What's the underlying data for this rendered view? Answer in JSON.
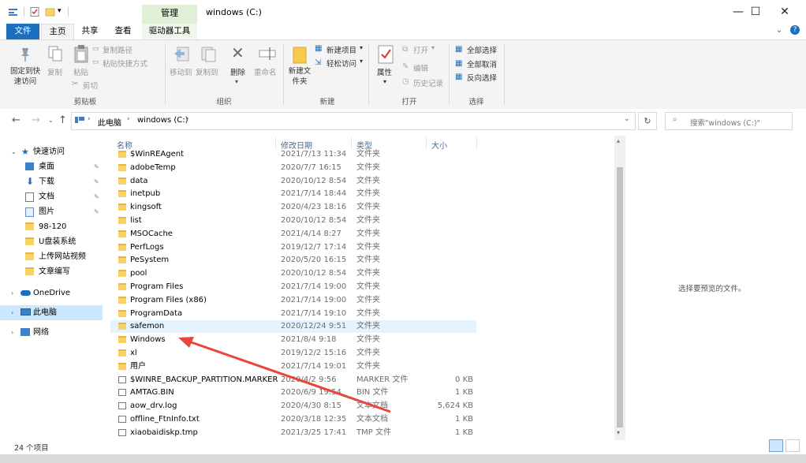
{
  "window": {
    "title": "windows (C:)",
    "contextual_tab": "管理",
    "controls": {
      "minimize": "—",
      "maximize": "☐",
      "close": "✕"
    }
  },
  "tabs": {
    "file": "文件",
    "home": "主页",
    "share": "共享",
    "view": "查看",
    "drive_tools": "驱动器工具"
  },
  "ribbon": {
    "clipboard": {
      "pin": "固定到快速访问",
      "copy": "复制",
      "paste": "粘贴",
      "copy_path": "复制路径",
      "paste_shortcut": "粘贴快捷方式",
      "cut": "剪切",
      "label": "剪贴板"
    },
    "organize": {
      "move_to": "移动到",
      "copy_to": "复制到",
      "delete": "删除",
      "rename": "重命名",
      "label": "组织"
    },
    "new": {
      "new_folder": "新建文件夹",
      "new_item": "新建项目",
      "easy_access": "轻松访问",
      "label": "新建"
    },
    "open": {
      "properties": "属性",
      "open": "打开",
      "edit": "编辑",
      "history": "历史记录",
      "label": "打开"
    },
    "select": {
      "select_all": "全部选择",
      "select_none": "全部取消",
      "invert": "反向选择",
      "label": "选择"
    }
  },
  "address": {
    "breadcrumb_1": "此电脑",
    "breadcrumb_2": "windows (C:)",
    "search_placeholder": "搜索\"windows (C:)\""
  },
  "nav": {
    "quick_access": "快速访问",
    "items": [
      {
        "label": "桌面",
        "pinned": true
      },
      {
        "label": "下载",
        "pinned": true
      },
      {
        "label": "文档",
        "pinned": true
      },
      {
        "label": "图片",
        "pinned": true
      },
      {
        "label": "98-120"
      },
      {
        "label": "U盘装系统"
      },
      {
        "label": "上传网站视频"
      },
      {
        "label": "文章编写"
      }
    ],
    "onedrive": "OneDrive",
    "this_pc": "此电脑",
    "network": "网络"
  },
  "columns": {
    "name": "名称",
    "date": "修改日期",
    "type": "类型",
    "size": "大小"
  },
  "files": [
    {
      "name": "$WinREAgent",
      "date": "2021/7/13 11:34",
      "type": "文件夹",
      "size": "",
      "kind": "folder"
    },
    {
      "name": "adobeTemp",
      "date": "2020/7/7 16:15",
      "type": "文件夹",
      "size": "",
      "kind": "folder"
    },
    {
      "name": "data",
      "date": "2020/10/12 8:54",
      "type": "文件夹",
      "size": "",
      "kind": "folder"
    },
    {
      "name": "inetpub",
      "date": "2021/7/14 18:44",
      "type": "文件夹",
      "size": "",
      "kind": "folder"
    },
    {
      "name": "kingsoft",
      "date": "2020/4/23 18:16",
      "type": "文件夹",
      "size": "",
      "kind": "folder"
    },
    {
      "name": "list",
      "date": "2020/10/12 8:54",
      "type": "文件夹",
      "size": "",
      "kind": "folder"
    },
    {
      "name": "MSOCache",
      "date": "2021/4/14 8:27",
      "type": "文件夹",
      "size": "",
      "kind": "folder"
    },
    {
      "name": "PerfLogs",
      "date": "2019/12/7 17:14",
      "type": "文件夹",
      "size": "",
      "kind": "folder"
    },
    {
      "name": "PeSystem",
      "date": "2020/5/20 16:15",
      "type": "文件夹",
      "size": "",
      "kind": "folder"
    },
    {
      "name": "pool",
      "date": "2020/10/12 8:54",
      "type": "文件夹",
      "size": "",
      "kind": "folder"
    },
    {
      "name": "Program Files",
      "date": "2021/7/14 19:00",
      "type": "文件夹",
      "size": "",
      "kind": "folder"
    },
    {
      "name": "Program Files (x86)",
      "date": "2021/7/14 19:00",
      "type": "文件夹",
      "size": "",
      "kind": "folder"
    },
    {
      "name": "ProgramData",
      "date": "2021/7/14 19:10",
      "type": "文件夹",
      "size": "",
      "kind": "folder"
    },
    {
      "name": "safemon",
      "date": "2020/12/24 9:51",
      "type": "文件夹",
      "size": "",
      "kind": "folder"
    },
    {
      "name": "Windows",
      "date": "2021/8/4 9:18",
      "type": "文件夹",
      "size": "",
      "kind": "folder"
    },
    {
      "name": "xl",
      "date": "2019/12/2 15:16",
      "type": "文件夹",
      "size": "",
      "kind": "folder"
    },
    {
      "name": "用户",
      "date": "2021/7/14 19:01",
      "type": "文件夹",
      "size": "",
      "kind": "folder"
    },
    {
      "name": "$WINRE_BACKUP_PARTITION.MARKER",
      "date": "2020/4/2 9:56",
      "type": "MARKER 文件",
      "size": "0 KB",
      "kind": "file"
    },
    {
      "name": "AMTAG.BIN",
      "date": "2020/6/9 19:54",
      "type": "BIN 文件",
      "size": "1 KB",
      "kind": "file"
    },
    {
      "name": "aow_drv.log",
      "date": "2020/4/30 8:15",
      "type": "文本文档",
      "size": "5,624 KB",
      "kind": "doc"
    },
    {
      "name": "offline_FtnInfo.txt",
      "date": "2020/3/18 12:35",
      "type": "文本文档",
      "size": "1 KB",
      "kind": "doc"
    },
    {
      "name": "xiaobaidiskp.tmp",
      "date": "2021/3/25 17:41",
      "type": "TMP 文件",
      "size": "1 KB",
      "kind": "file"
    }
  ],
  "preview_text": "选择要预览的文件。",
  "status": {
    "count": "24 个项目"
  },
  "colors": {
    "accent": "#1a6fbf",
    "arrow": "#e8453c",
    "hover": "#e5f3ff",
    "selected": "#cce8ff"
  }
}
